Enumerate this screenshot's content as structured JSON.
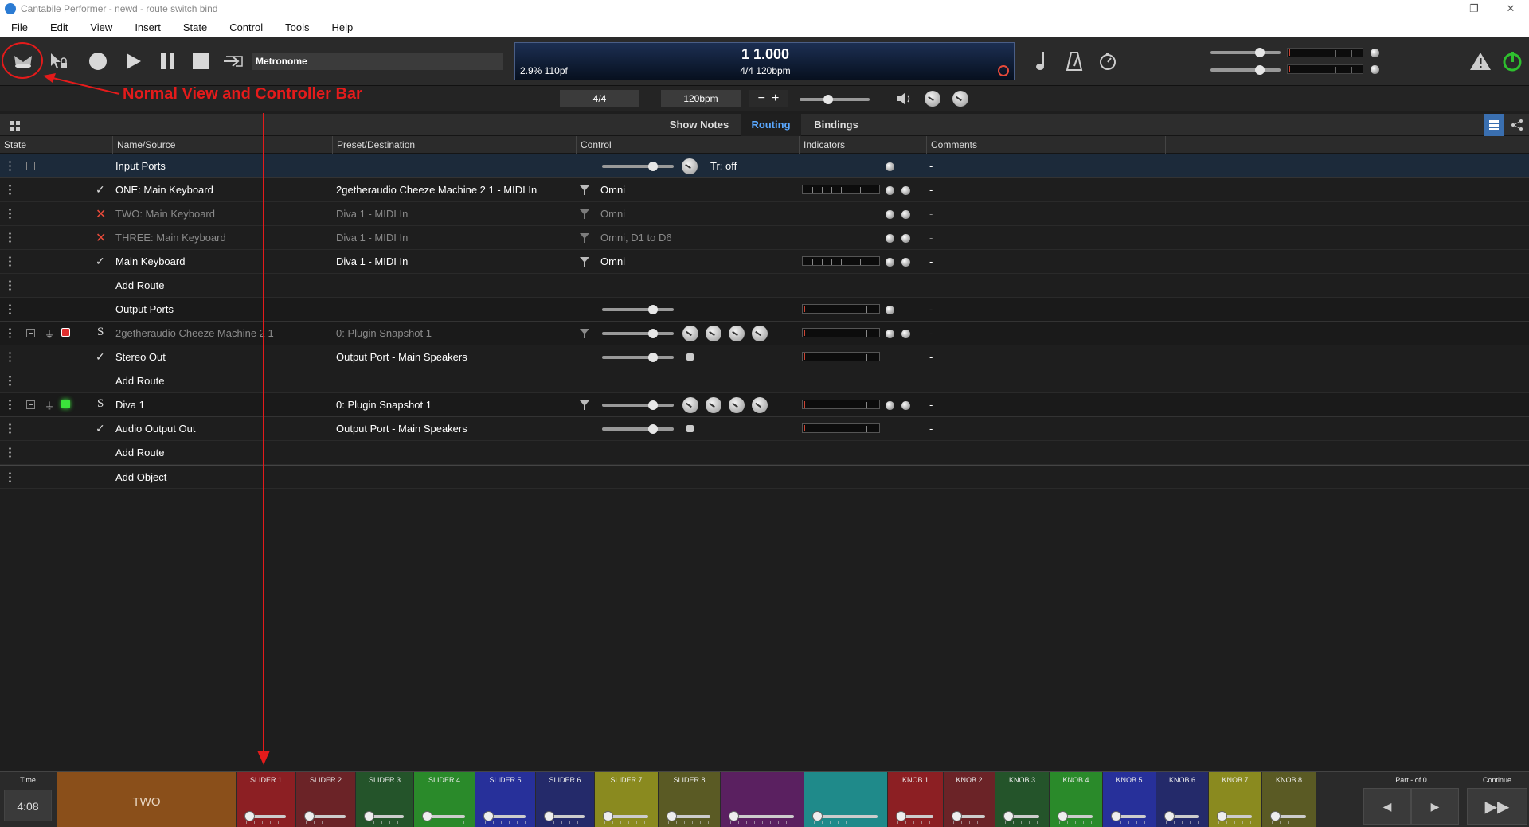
{
  "window": {
    "title": "Cantabile Performer - newd - route switch bind",
    "controls": [
      "—",
      "❐",
      "✕"
    ]
  },
  "menu": [
    "File",
    "Edit",
    "View",
    "Insert",
    "State",
    "Control",
    "Tools",
    "Help"
  ],
  "toolbar": {
    "metronome_label": "Metronome",
    "position": "1 1.000",
    "time_sig_tempo": "4/4 120bpm",
    "cpu": "2.9%  110pf",
    "time_signature_field": "4/4",
    "tempo_field": "120bpm",
    "tempo_minus": "−",
    "tempo_plus": "+"
  },
  "annotation": {
    "label": "Normal View and Controller Bar"
  },
  "tabs": [
    {
      "label": "Show Notes",
      "active": false
    },
    {
      "label": "Routing",
      "active": true
    },
    {
      "label": "Bindings",
      "active": false
    }
  ],
  "columns": [
    "State",
    "Name/Source",
    "Preset/Destination",
    "Control",
    "Indicators",
    "Comments"
  ],
  "rows": [
    {
      "name": "Input Ports",
      "dest": "",
      "ctrl": "Tr: off",
      "comment": "-"
    },
    {
      "name": "ONE: Main Keyboard",
      "dest": "2getheraudio Cheeze Machine 2 1 - MIDI In",
      "ctrl": "Omni",
      "comment": "-"
    },
    {
      "name": "TWO: Main Keyboard",
      "dest": "Diva 1 - MIDI In",
      "ctrl": "Omni",
      "comment": "-"
    },
    {
      "name": "THREE: Main Keyboard",
      "dest": "Diva 1 - MIDI In",
      "ctrl": "Omni, D1 to D6",
      "comment": "-"
    },
    {
      "name": "Main Keyboard",
      "dest": "Diva 1 - MIDI In",
      "ctrl": "Omni",
      "comment": "-"
    },
    {
      "name": "Add Route",
      "dest": "",
      "ctrl": "",
      "comment": ""
    },
    {
      "name": "Output Ports",
      "dest": "",
      "ctrl": "",
      "comment": "-"
    },
    {
      "name": "2getheraudio Cheeze Machine 2 1",
      "dest": "0: Plugin Snapshot 1",
      "ctrl": "",
      "comment": "-"
    },
    {
      "name": "Stereo Out",
      "dest": "Output Port - Main Speakers",
      "ctrl": "",
      "comment": "-"
    },
    {
      "name": "Add Route",
      "dest": "",
      "ctrl": "",
      "comment": ""
    },
    {
      "name": "Diva 1",
      "dest": "0: Plugin Snapshot 1",
      "ctrl": "",
      "comment": "-"
    },
    {
      "name": "Audio Output Out",
      "dest": "Output Port - Main Speakers",
      "ctrl": "",
      "comment": "-"
    },
    {
      "name": "Add Route",
      "dest": "",
      "ctrl": "",
      "comment": ""
    },
    {
      "name": "Add Object",
      "dest": "",
      "ctrl": "",
      "comment": ""
    }
  ],
  "plugin_state_letter": "S",
  "controller_bar": {
    "time_label": "Time",
    "time_value": "4:08",
    "song": "TWO",
    "controls": [
      {
        "label": "SLIDER 1",
        "color": "#8c1f23"
      },
      {
        "label": "SLIDER 2",
        "color": "#6b2327"
      },
      {
        "label": "SLIDER 3",
        "color": "#24542a"
      },
      {
        "label": "SLIDER 4",
        "color": "#2a8a2a"
      },
      {
        "label": "SLIDER 5",
        "color": "#27309a"
      },
      {
        "label": "SLIDER 6",
        "color": "#242a6a"
      },
      {
        "label": "SLIDER 7",
        "color": "#8a8a1f"
      },
      {
        "label": "SLIDER 8",
        "color": "#5a5a24"
      },
      {
        "label": "",
        "color": "#5a2060"
      },
      {
        "label": "",
        "color": "#1f8a8a"
      },
      {
        "label": "KNOB 1",
        "color": "#8c1f23"
      },
      {
        "label": "KNOB 2",
        "color": "#6b2327"
      },
      {
        "label": "KNOB 3",
        "color": "#24542a"
      },
      {
        "label": "KNOB 4",
        "color": "#2a8a2a"
      },
      {
        "label": "KNOB 5",
        "color": "#27309a"
      },
      {
        "label": "KNOB 6",
        "color": "#242a6a"
      },
      {
        "label": "KNOB 7",
        "color": "#8a8a1f"
      },
      {
        "label": "KNOB 8",
        "color": "#5a5a24"
      }
    ],
    "part_label": "Part - of 0",
    "continue_label": "Continue"
  },
  "colors": {
    "accent": "#5aa8ff",
    "annotation": "#e41b1b",
    "power": "#2ec02e"
  }
}
